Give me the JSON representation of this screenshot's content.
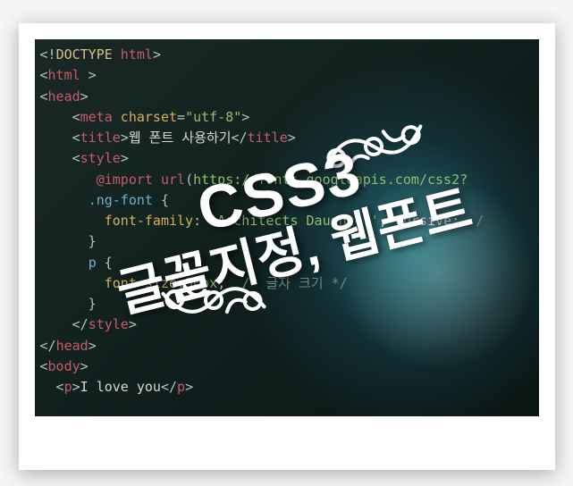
{
  "code": {
    "l1_a": "<!",
    "l1_b": "DOCTYPE",
    "l1_c": " html",
    "l1_d": ">",
    "l2_a": "<",
    "l2_b": "html",
    "l2_c": " >",
    "l3_a": "<",
    "l3_b": "head",
    "l3_c": ">",
    "l4_a": "    <",
    "l4_b": "meta",
    "l4_c": " charset",
    "l4_d": "=",
    "l4_e": "\"utf-8\"",
    "l4_f": ">",
    "l5_a": "    <",
    "l5_b": "title",
    "l5_c": ">",
    "l5_d": "웹 폰트 사용하기",
    "l5_e": "</",
    "l5_f": "title",
    "l5_g": ">",
    "l6_a": "    <",
    "l6_b": "style",
    "l6_c": ">",
    "l7_a": "       ",
    "l7_b": "@import",
    "l7_c": " url",
    "l7_d": "(",
    "l7_e": "https://fonts.googleapis.com/css2?",
    "l8_a": "      ",
    "l8_b": ".ng-font",
    "l8_c": " {",
    "l9_a": "        ",
    "l9_b": "font-family",
    "l9_c": ": ",
    "l9_d": "'Architects Daughter'",
    "l9_e": ", cursive;  ",
    "l9_f": "/",
    "l10_a": "      }",
    "l11_a": "      ",
    "l11_b": "p",
    "l11_c": " {",
    "l12_a": "        ",
    "l12_b": "font-size",
    "l12_c": ":",
    "l12_d": "30px",
    "l12_e": ";  ",
    "l12_f": "/* 글자 크기 */",
    "l13_a": "      }",
    "l14_a": "    </",
    "l14_b": "style",
    "l14_c": ">",
    "l15_a": "</",
    "l15_b": "head",
    "l15_c": ">",
    "l16_a": "<",
    "l16_b": "body",
    "l16_c": ">",
    "l17_a": "  <",
    "l17_b": "p",
    "l17_c": ">",
    "l17_d": "I love you",
    "l17_e": "</",
    "l17_f": "p",
    "l17_g": ">"
  },
  "overlay": {
    "line1": "CSS3",
    "line2": "글꼴지정, 웹폰트"
  }
}
